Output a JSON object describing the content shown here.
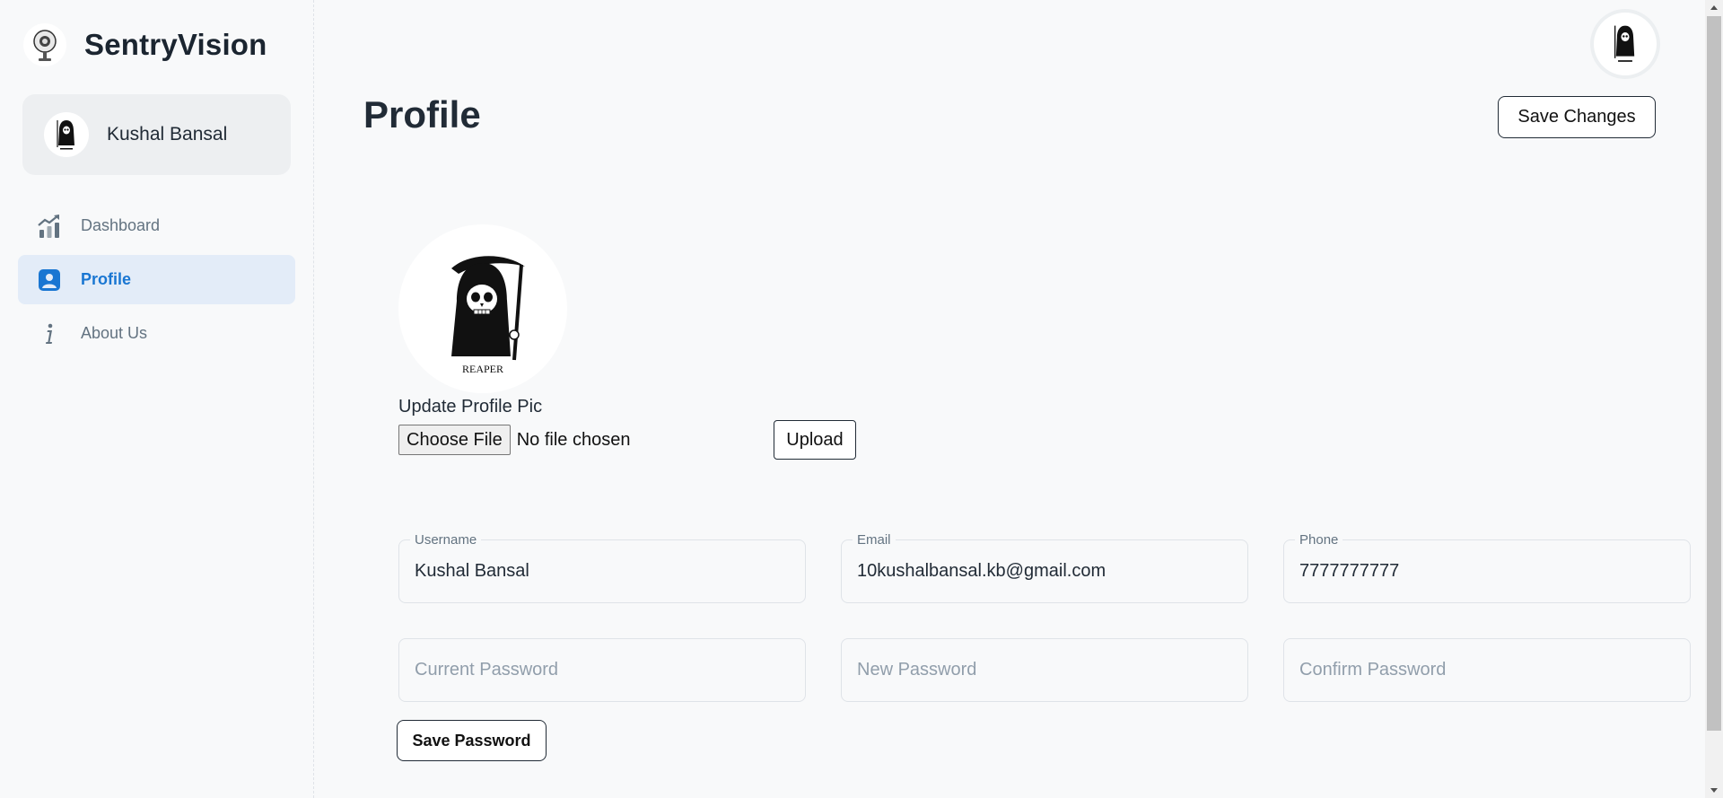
{
  "app": {
    "name": "SentryVision"
  },
  "user": {
    "name": "Kushal Bansal"
  },
  "nav": {
    "items": [
      {
        "label": "Dashboard",
        "icon": "chart-growth-icon",
        "active": false
      },
      {
        "label": "Profile",
        "icon": "user-badge-icon",
        "active": true
      },
      {
        "label": "About Us",
        "icon": "info-icon",
        "active": false
      }
    ]
  },
  "page": {
    "title": "Profile",
    "save_changes_label": "Save Changes"
  },
  "profile_pic": {
    "caption": "REAPER",
    "update_label": "Update Profile Pic",
    "choose_file_label": "Choose File",
    "file_status": "No file chosen",
    "upload_label": "Upload"
  },
  "form": {
    "username": {
      "label": "Username",
      "value": "Kushal Bansal"
    },
    "email": {
      "label": "Email",
      "value": "10kushalbansal.kb@gmail.com"
    },
    "phone": {
      "label": "Phone",
      "value": "7777777777"
    },
    "current_password": {
      "placeholder": "Current Password"
    },
    "new_password": {
      "placeholder": "New Password"
    },
    "confirm_password": {
      "placeholder": "Confirm Password"
    },
    "save_password_label": "Save Password"
  },
  "colors": {
    "accent": "#1976d2",
    "active_bg": "#e3ecf8",
    "text": "#212b36"
  }
}
